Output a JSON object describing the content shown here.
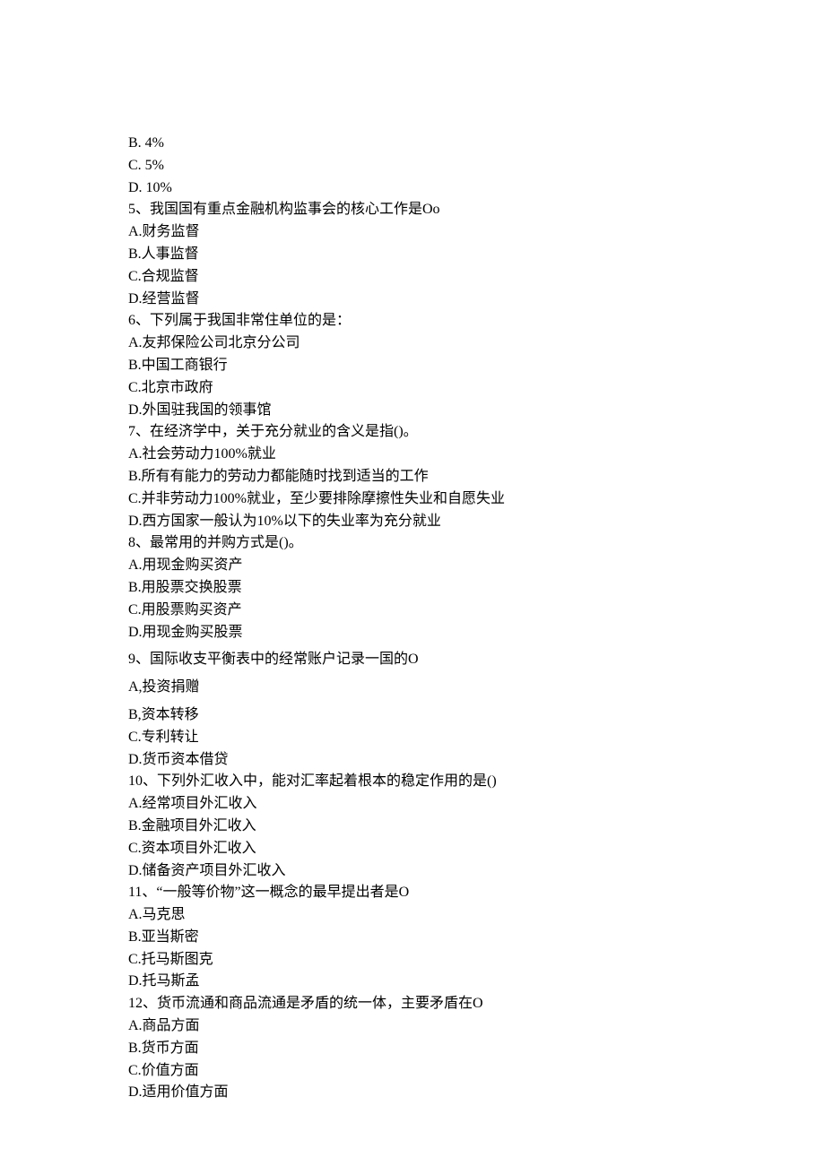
{
  "lines": [
    "B.   4%",
    "C.   5%",
    "D.   10%",
    "5、我国国有重点金融机构监事会的核心工作是Oo",
    "A.财务监督",
    "B.人事监督",
    "C.合规监督",
    "D.经营监督",
    "6、下列属于我国非常住单位的是：",
    "A.友邦保险公司北京分公司",
    "B.中国工商银行",
    "C.北京市政府",
    "D.外国驻我国的领事馆",
    "7、在经济学中，关于充分就业的含义是指()。",
    "A.社会劳动力100%就业",
    "B.所有有能力的劳动力都能随时找到适当的工作",
    "C.并非劳动力100%就业，至少要排除摩擦性失业和自愿失业",
    "D.西方国家一般认为10%以下的失业率为充分就业",
    "8、最常用的并购方式是()。",
    "A.用现金购买资产",
    "B.用股票交换股票",
    "C.用股票购买资产",
    "D.用现金购买股票",
    "9、国际收支平衡表中的经常账户记录一国的O",
    "A,投资捐赠",
    "B,资本转移",
    "C.专利转让",
    "D.货币资本借贷",
    "10、下列外汇收入中，能对汇率起着根本的稳定作用的是()",
    "A.经常项目外汇收入",
    "B.金融项目外汇收入",
    "C.资本项目外汇收入",
    "D.储备资产项目外汇收入",
    "11、“一般等价物”这一概念的最早提出者是O",
    "A.马克思",
    "B.亚当斯密",
    "C.托马斯图克",
    "D.托马斯孟",
    "12、货币流通和商品流通是矛盾的统一体，主要矛盾在O",
    "A.商品方面",
    "B.货币方面",
    "C.价值方面",
    "D.适用价值方面"
  ],
  "gap_indices": [
    23,
    24,
    25
  ]
}
